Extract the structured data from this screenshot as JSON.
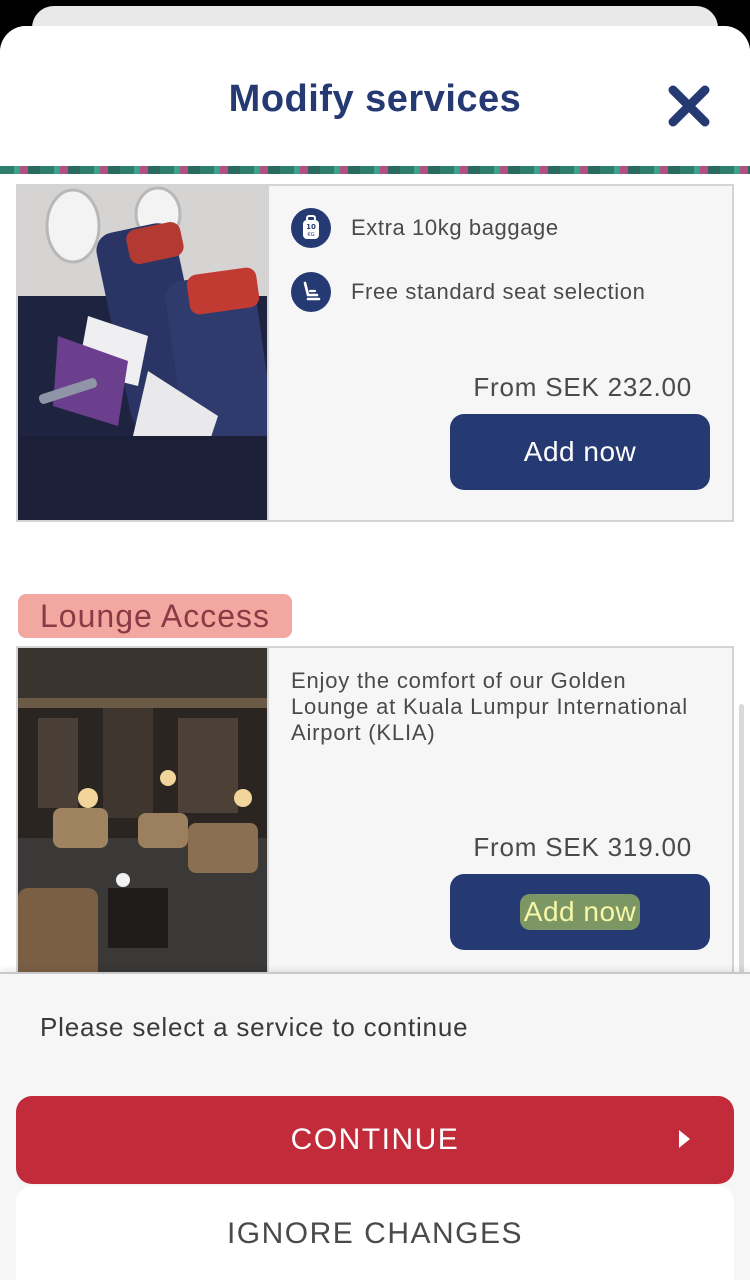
{
  "header": {
    "title": "Modify services",
    "close_icon": "close-icon"
  },
  "bundle_card": {
    "features": [
      {
        "icon": "baggage-10kg-icon",
        "text": "Extra 10kg baggage"
      },
      {
        "icon": "seat-icon",
        "text": "Free standard seat selection"
      }
    ],
    "price": "From SEK 232.00",
    "button": "Add now"
  },
  "lounge": {
    "section_title": "Lounge Access",
    "description": "Enjoy the comfort of our Golden Lounge at Kuala Lumpur International Airport (KLIA)",
    "price": "From SEK 319.00",
    "button": "Add now"
  },
  "footer": {
    "message": "Please select a service to continue",
    "continue": "CONTINUE",
    "ignore": "IGNORE CHANGES"
  },
  "colors": {
    "navy": "#253a73",
    "red": "#c22b3a",
    "highlight_pink": "#f2a8a0",
    "highlight_yellow": "#c4e258"
  }
}
